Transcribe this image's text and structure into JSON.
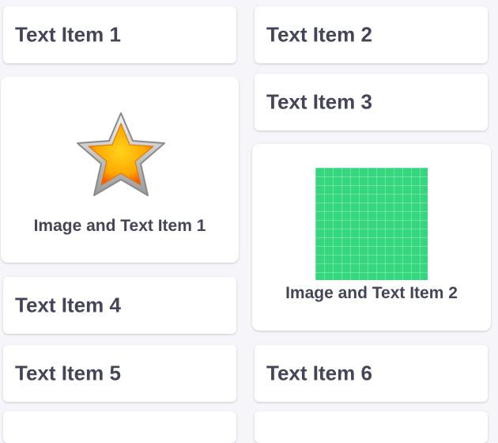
{
  "list": {
    "items": [
      {
        "type": "text",
        "label": "Text Item 1"
      },
      {
        "type": "text",
        "label": "Text Item 2"
      },
      {
        "type": "text",
        "label": "Text Item 3"
      },
      {
        "type": "image-text",
        "label": "Image and Text Item 1",
        "icon": "star-icon"
      },
      {
        "type": "image-text",
        "label": "Image and Text Item 2",
        "icon": "green-grid-image"
      },
      {
        "type": "text",
        "label": "Text Item 4"
      },
      {
        "type": "text",
        "label": "Text Item 5"
      },
      {
        "type": "text",
        "label": "Text Item 6"
      }
    ]
  },
  "colors": {
    "background": "#f6f6fa",
    "card": "#ffffff",
    "text": "#454559",
    "grid_image": "#34d67e",
    "star_fill": "#ffb300"
  }
}
